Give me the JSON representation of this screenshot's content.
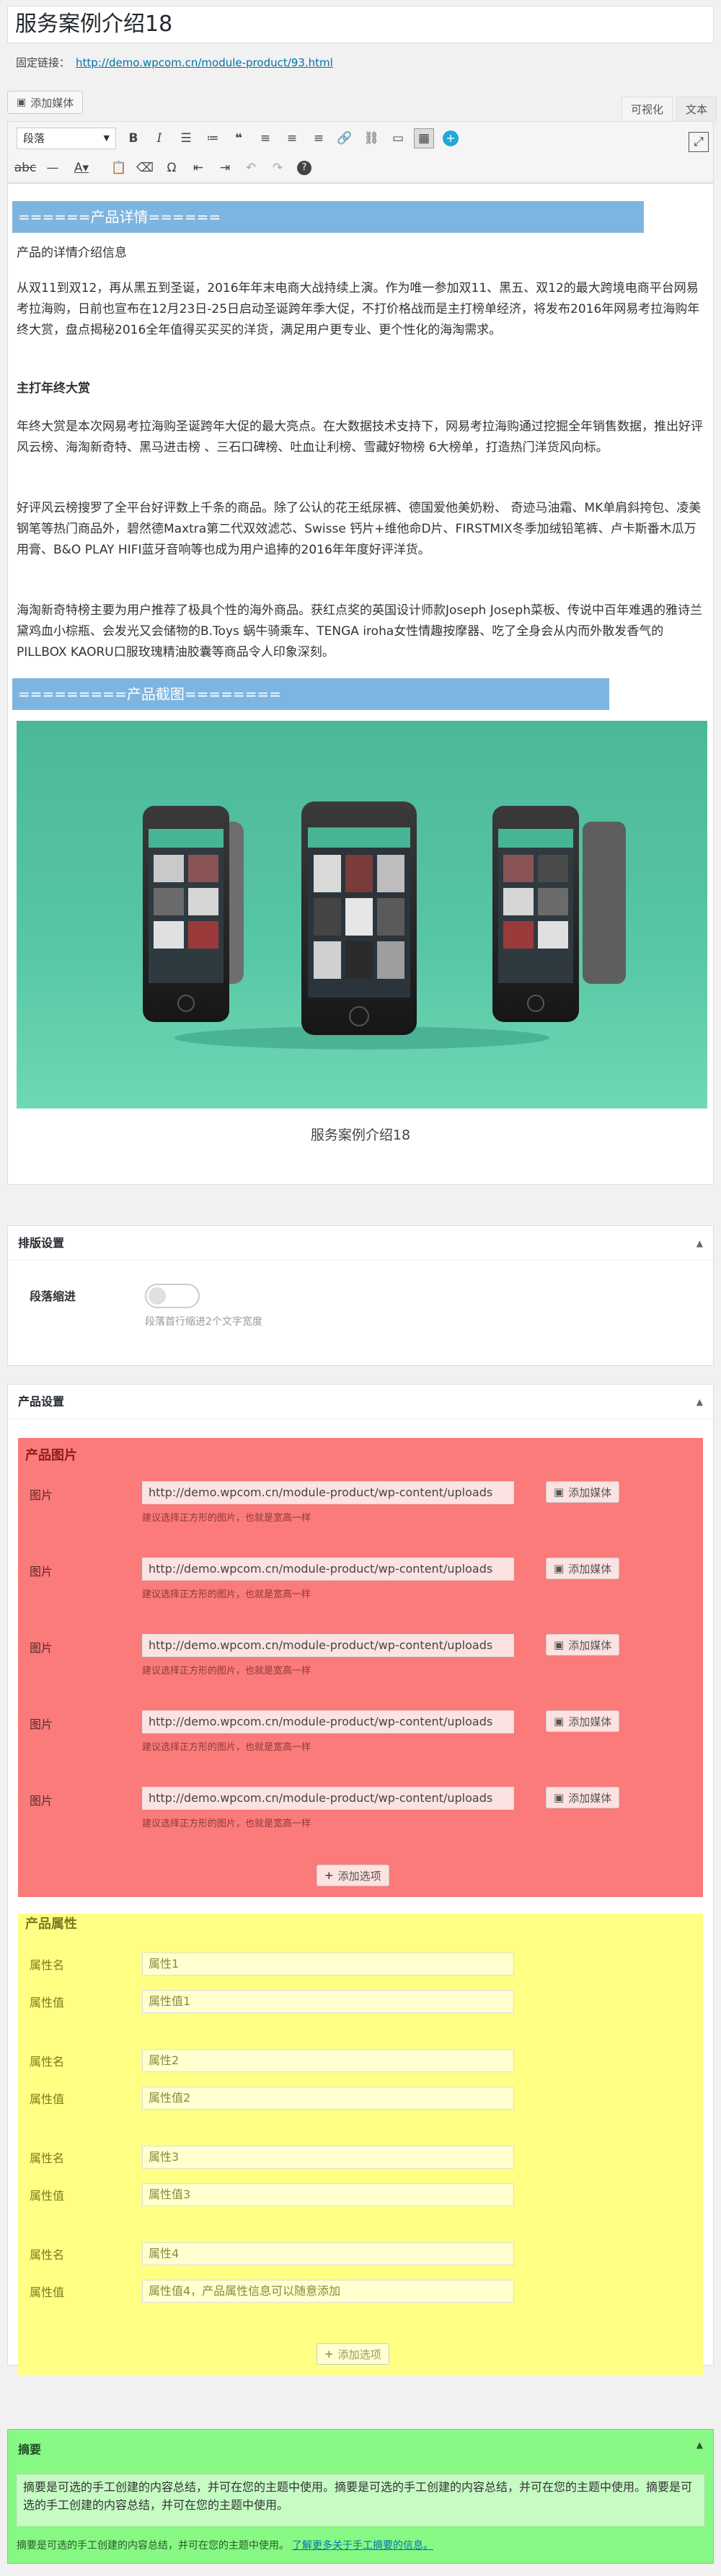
{
  "post": {
    "title": "服务案例介绍18",
    "permalink_label": "固定链接：",
    "permalink_url": "http://demo.wpcom.cn/module-product/93.html"
  },
  "editor": {
    "add_media_label": "添加媒体",
    "tab_visual": "可视化",
    "tab_text": "文本",
    "format_select": "段落",
    "toolbar_icons": [
      "bold-icon",
      "italic-icon",
      "bullet-list-icon",
      "numbered-list-icon",
      "blockquote-icon",
      "align-left-icon",
      "align-center-icon",
      "align-right-icon",
      "link-icon",
      "unlink-icon",
      "read-more-icon",
      "toolbar-toggle-icon",
      "plus-icon",
      "strikethrough-icon",
      "horizontal-line-icon",
      "text-color-icon",
      "paste-text-icon",
      "clear-format-icon",
      "special-char-icon",
      "outdent-icon",
      "indent-icon",
      "undo-icon",
      "redo-icon",
      "help-icon",
      "fullscreen-icon"
    ]
  },
  "content": {
    "section1_heading": "======产品详情======",
    "p1": "产品的详情介绍信息",
    "p2": "从双11到双12，再从黑五到圣诞，2016年年末电商大战持续上演。作为唯一参加双11、黑五、双12的最大跨境电商平台网易考拉海购，日前也宣布在12月23日-25日启动圣诞跨年季大促，不打价格战而是主打榜单经济，将发布2016年网易考拉海购年终大赏，盘点揭秘2016全年值得买买买的洋货，满足用户更专业、更个性化的海淘需求。",
    "h_bold": "主打年终大赏",
    "p3": "年终大赏是本次网易考拉海购圣诞跨年大促的最大亮点。在大数据技术支持下，网易考拉海购通过挖掘全年销售数据，推出好评风云榜、海淘新奇特、黑马进击榜 、三石口碑榜、吐血让利榜、雪藏好物榜 6大榜单，打造热门洋货风向标。",
    "p4": "好评风云榜搜罗了全平台好评数上千条的商品。除了公认的花王纸尿裤、德国爱他美奶粉、 奇迹马油霜、MK单肩斜挎包、凌美钢笔等热门商品外，碧然德Maxtra第二代双效滤芯、Swisse 钙片+维他命D片、FIRSTMIX冬季加绒铅笔裤、卢卡斯番木瓜万用膏、B&O PLAY HIFI蓝牙音响等也成为用户追捧的2016年年度好评洋货。",
    "p5": "海淘新奇特榜主要为用户推荐了极具个性的海外商品。获红点奖的英国设计师款Joseph Joseph菜板、传说中百年难遇的雅诗兰黛鸡血小棕瓶、会发光又会储物的B.Toys 蜗牛骑乘车、TENGA iroha女性情趣按摩器、吃了全身会从内而外散发香气的PILLBOX KAORU口服玫瑰精油胶囊等商品令人印象深刻。",
    "section2_heading": "=========产品截图========",
    "caption": "服务案例介绍18"
  },
  "layout_panel": {
    "title": "排版设置",
    "indent_label": "段落缩进",
    "indent_on": false,
    "indent_help": "段落首行缩进2个文字宽度"
  },
  "product_panel": {
    "title": "产品设置",
    "images_title": "产品图片",
    "image_label": "图片",
    "image_help": "建议选择正方形的图片，也就是宽高一样",
    "add_media": "添加媒体",
    "images": [
      "http://demo.wpcom.cn/module-product/wp-content/uploads",
      "http://demo.wpcom.cn/module-product/wp-content/uploads",
      "http://demo.wpcom.cn/module-product/wp-content/uploads",
      "http://demo.wpcom.cn/module-product/wp-content/uploads",
      "http://demo.wpcom.cn/module-product/wp-content/uploads"
    ],
    "add_option": "添加选项",
    "attrs_title": "产品属性",
    "attr_name_label": "属性名",
    "attr_value_label": "属性值",
    "attrs": [
      {
        "name": "属性1",
        "value": "属性值1"
      },
      {
        "name": "属性2",
        "value": "属性值2"
      },
      {
        "name": "属性3",
        "value": "属性值3"
      },
      {
        "name": "属性4",
        "value": "属性值4，产品属性信息可以随意添加"
      }
    ]
  },
  "summary_panel": {
    "title": "摘要",
    "text": "摘要是可选的手工创建的内容总结，并可在您的主题中使用。摘要是可选的手工创建的内容总结，并可在您的主题中使用。摘要是可选的手工创建的内容总结，并可在您的主题中使用。",
    "help": "摘要是可选的手工创建的内容总结，并可在您的主题中使用。",
    "help_link": "了解更多关于手工摘要的信息。"
  },
  "colors": {
    "blue_heading": "#7eb5e0",
    "red_box": "#fb7a7a",
    "yellow_box": "#ffff84",
    "green_box": "#87f884",
    "teal_image": "#58c7a5"
  }
}
